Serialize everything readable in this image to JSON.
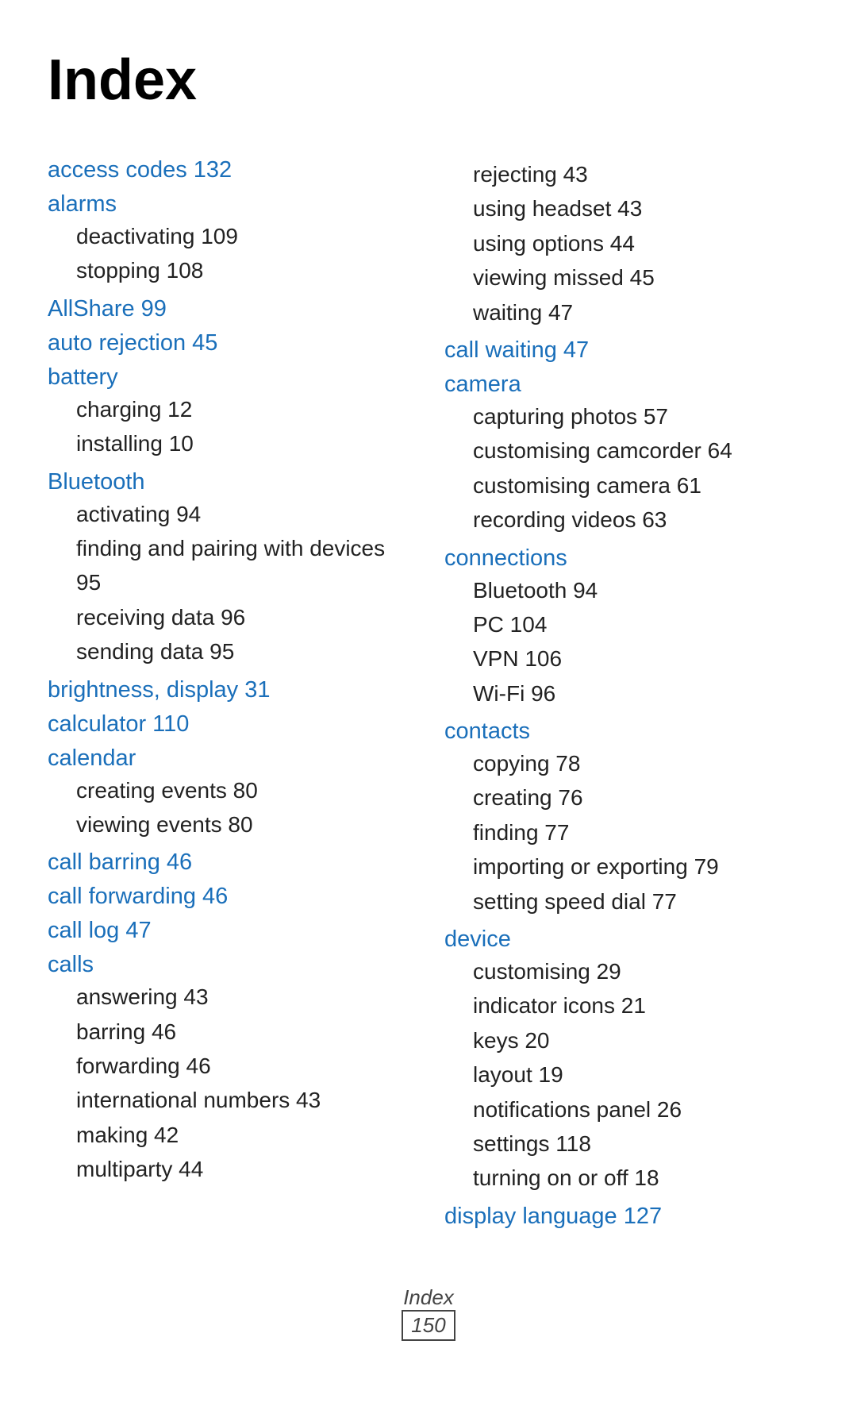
{
  "page": {
    "title": "Index",
    "footer_label": "Index",
    "footer_page": "150"
  },
  "left_column": [
    {
      "term": "access codes",
      "term_page": "132",
      "subitems": []
    },
    {
      "term": "alarms",
      "term_page": null,
      "subitems": [
        {
          "text": "deactivating",
          "page": "109"
        },
        {
          "text": "stopping",
          "page": "108"
        }
      ]
    },
    {
      "term": "AllShare",
      "term_page": "99",
      "subitems": []
    },
    {
      "term": "auto rejection",
      "term_page": "45",
      "subitems": []
    },
    {
      "term": "battery",
      "term_page": null,
      "subitems": [
        {
          "text": "charging",
          "page": "12"
        },
        {
          "text": "installing",
          "page": "10"
        }
      ]
    },
    {
      "term": "Bluetooth",
      "term_page": null,
      "subitems": [
        {
          "text": "activating",
          "page": "94"
        },
        {
          "text": "finding and pairing with devices",
          "page": "95"
        },
        {
          "text": "receiving data",
          "page": "96"
        },
        {
          "text": "sending data",
          "page": "95"
        }
      ]
    },
    {
      "term": "brightness, display",
      "term_page": "31",
      "subitems": []
    },
    {
      "term": "calculator",
      "term_page": "110",
      "subitems": []
    },
    {
      "term": "calendar",
      "term_page": null,
      "subitems": [
        {
          "text": "creating events",
          "page": "80"
        },
        {
          "text": "viewing events",
          "page": "80"
        }
      ]
    },
    {
      "term": "call barring",
      "term_page": "46",
      "subitems": []
    },
    {
      "term": "call forwarding",
      "term_page": "46",
      "subitems": []
    },
    {
      "term": "call log",
      "term_page": "47",
      "subitems": []
    },
    {
      "term": "calls",
      "term_page": null,
      "subitems": [
        {
          "text": "answering",
          "page": "43"
        },
        {
          "text": "barring",
          "page": "46"
        },
        {
          "text": "forwarding",
          "page": "46"
        },
        {
          "text": "international numbers",
          "page": "43"
        },
        {
          "text": "making",
          "page": "42"
        },
        {
          "text": "multiparty",
          "page": "44"
        }
      ]
    }
  ],
  "right_column": [
    {
      "term": null,
      "term_page": null,
      "subitems": [
        {
          "text": "rejecting",
          "page": "43"
        },
        {
          "text": "using headset",
          "page": "43"
        },
        {
          "text": "using options",
          "page": "44"
        },
        {
          "text": "viewing missed",
          "page": "45"
        },
        {
          "text": "waiting",
          "page": "47"
        }
      ]
    },
    {
      "term": "call waiting",
      "term_page": "47",
      "subitems": []
    },
    {
      "term": "camera",
      "term_page": null,
      "subitems": [
        {
          "text": "capturing photos",
          "page": "57"
        },
        {
          "text": "customising camcorder",
          "page": "64"
        },
        {
          "text": "customising camera",
          "page": "61"
        },
        {
          "text": "recording videos",
          "page": "63"
        }
      ]
    },
    {
      "term": "connections",
      "term_page": null,
      "subitems": [
        {
          "text": "Bluetooth",
          "page": "94"
        },
        {
          "text": "PC",
          "page": "104"
        },
        {
          "text": "VPN",
          "page": "106"
        },
        {
          "text": "Wi-Fi",
          "page": "96"
        }
      ]
    },
    {
      "term": "contacts",
      "term_page": null,
      "subitems": [
        {
          "text": "copying",
          "page": "78"
        },
        {
          "text": "creating",
          "page": "76"
        },
        {
          "text": "finding",
          "page": "77"
        },
        {
          "text": "importing or exporting",
          "page": "79"
        },
        {
          "text": "setting speed dial",
          "page": "77"
        }
      ]
    },
    {
      "term": "device",
      "term_page": null,
      "subitems": [
        {
          "text": "customising",
          "page": "29"
        },
        {
          "text": "indicator icons",
          "page": "21"
        },
        {
          "text": "keys",
          "page": "20"
        },
        {
          "text": "layout",
          "page": "19"
        },
        {
          "text": "notifications panel",
          "page": "26"
        },
        {
          "text": "settings",
          "page": "118"
        },
        {
          "text": "turning on or off",
          "page": "18"
        }
      ]
    },
    {
      "term": "display language",
      "term_page": "127",
      "subitems": []
    }
  ]
}
